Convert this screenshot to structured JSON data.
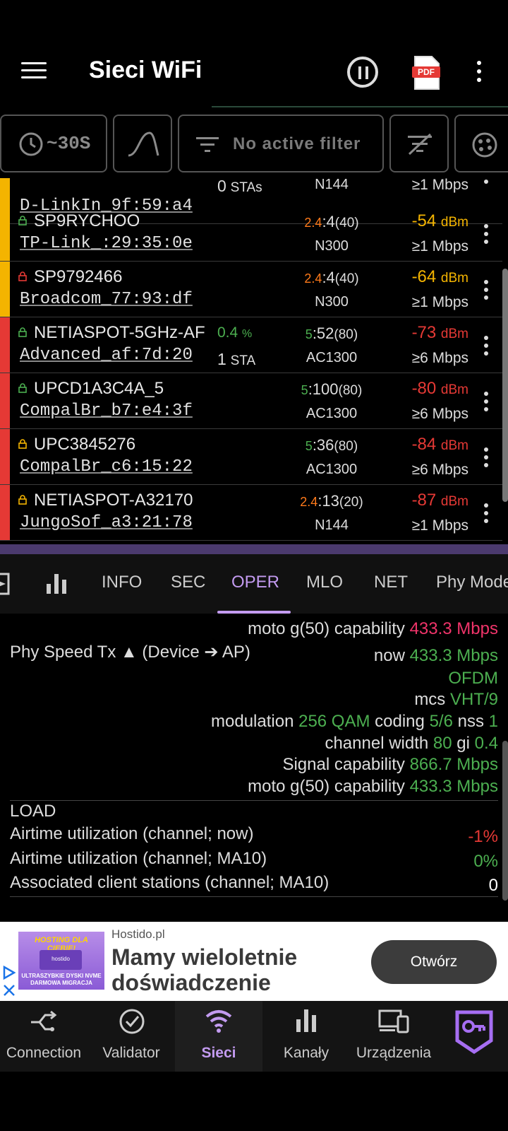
{
  "app": {
    "title": "Sieci WiFi",
    "pdf_label": "PDF"
  },
  "filter_bar": {
    "timer_label": "~30S",
    "filter_label": "No active filter"
  },
  "networks": [
    {
      "ssid": "",
      "bssid": "D-LinkIn_9f:59:a4",
      "stas": "0",
      "stas_unit": "STAs",
      "band": "",
      "channel": "",
      "width": "",
      "standard": "N144",
      "signal": "",
      "signal_unit": "",
      "rate": "≥1 Mbps",
      "util": "",
      "util_unit": "",
      "bar_color": "#f4b400",
      "lock_color": "",
      "signal_color": ""
    },
    {
      "ssid": "SP9RYCHOO",
      "bssid": "TP-Link_:29:35:0e",
      "stas": "",
      "stas_unit": "",
      "band": "2.4",
      "channel": ":4",
      "width": "(40)",
      "standard": "N300",
      "signal": "-54",
      "signal_unit": "dBm",
      "rate": "≥1 Mbps",
      "util": "",
      "util_unit": "",
      "bar_color": "#f4b400",
      "lock_color": "#4caf50",
      "signal_color": "#f4b400"
    },
    {
      "ssid": "SP9792466",
      "bssid": "Broadcom_77:93:df",
      "stas": "",
      "stas_unit": "",
      "band": "2.4",
      "channel": ":4",
      "width": "(40)",
      "standard": "N300",
      "signal": "-64",
      "signal_unit": "dBm",
      "rate": "≥1 Mbps",
      "util": "",
      "util_unit": "",
      "bar_color": "#f4b400",
      "lock_color": "#e53935",
      "signal_color": "#f4b400"
    },
    {
      "ssid": "NETIASPOT-5GHz-AF",
      "bssid": "Advanced_af:7d:20",
      "stas": "1",
      "stas_unit": "STA",
      "band": "5",
      "channel": ":52",
      "width": "(80)",
      "standard": "AC1300",
      "signal": "-73",
      "signal_unit": "dBm",
      "rate": "≥6 Mbps",
      "util": "0.4",
      "util_unit": "%",
      "bar_color": "#e53935",
      "lock_color": "#4caf50",
      "signal_color": "#e53935"
    },
    {
      "ssid": "UPCD1A3C4A_5",
      "bssid": "CompalBr_b7:e4:3f",
      "stas": "",
      "stas_unit": "",
      "band": "5",
      "channel": ":100",
      "width": "(80)",
      "standard": "AC1300",
      "signal": "-80",
      "signal_unit": "dBm",
      "rate": "≥6 Mbps",
      "util": "",
      "util_unit": "",
      "bar_color": "#e53935",
      "lock_color": "#4caf50",
      "signal_color": "#e53935"
    },
    {
      "ssid": "UPC3845276",
      "bssid": "CompalBr_c6:15:22",
      "stas": "",
      "stas_unit": "",
      "band": "5",
      "channel": ":36",
      "width": "(80)",
      "standard": "AC1300",
      "signal": "-84",
      "signal_unit": "dBm",
      "rate": "≥6 Mbps",
      "util": "",
      "util_unit": "",
      "bar_color": "#e53935",
      "lock_color": "#f4b400",
      "signal_color": "#e53935"
    },
    {
      "ssid": "NETIASPOT-A32170",
      "bssid": "JungoSof_a3:21:78",
      "stas": "",
      "stas_unit": "",
      "band": "2.4",
      "channel": ":13",
      "width": "(20)",
      "standard": "N144",
      "signal": "-87",
      "signal_unit": "dBm",
      "rate": "≥1 Mbps",
      "util": "",
      "util_unit": "",
      "bar_color": "#e53935",
      "lock_color": "#f4b400",
      "signal_color": "#e53935"
    }
  ],
  "tabs": [
    "INFO",
    "SEC",
    "OPER",
    "MLO",
    "NET",
    "Phy Mode"
  ],
  "active_tab": "OPER",
  "detail": {
    "top_line_label": "moto g(50) capability",
    "top_line_value": "433.3 Mbps",
    "tx_title": "Phy Speed Tx ▲ (Device ➔ AP)",
    "now_label": "now",
    "now_value": "433.3 Mbps",
    "ofdm": "OFDM",
    "mcs_label": "mcs",
    "mcs_value": "VHT/9",
    "modulation_label": "modulation",
    "modulation_value": "256 QAM",
    "coding_label": "coding",
    "coding_value": "5/6",
    "nss_label": "nss",
    "nss_value": "1",
    "cw_label": "channel width",
    "cw_value": "80",
    "gi_label": "gi",
    "gi_value": "0.4",
    "sigcap_label": "Signal capability",
    "sigcap_value": "866.7 Mbps",
    "devcap_label": "moto g(50) capability",
    "devcap_value": "433.3 Mbps",
    "load_title": "LOAD",
    "air_now_label": "Airtime utilization (channel; now)",
    "air_now_value": "-1%",
    "air_ma_label": "Airtime utilization (channel; MA10)",
    "air_ma_value": "0%",
    "assoc_label": "Associated client stations (channel; MA10)",
    "assoc_value": "0"
  },
  "ad": {
    "advertiser": "Hostido.pl",
    "headline_line1": "Mamy wieloletnie",
    "headline_line2": "doświadczenie",
    "button": "Otwórz",
    "image_text_top": "HOSTING DLA CIEBIE!",
    "image_text_bottom": "ULTRASZYBKIE DYSKI NVME DARMOWA MIGRACJA",
    "image_brand": "hostido"
  },
  "nav": [
    {
      "label": "Connection"
    },
    {
      "label": "Validator"
    },
    {
      "label": "Sieci"
    },
    {
      "label": "Kanały"
    },
    {
      "label": "Urządzenia"
    }
  ],
  "colors": {
    "accent": "#c39bf0",
    "green": "#4caf50",
    "red": "#e53935",
    "orange": "#ff7a1a",
    "yellow": "#f4b400",
    "pink": "#f0346a"
  }
}
